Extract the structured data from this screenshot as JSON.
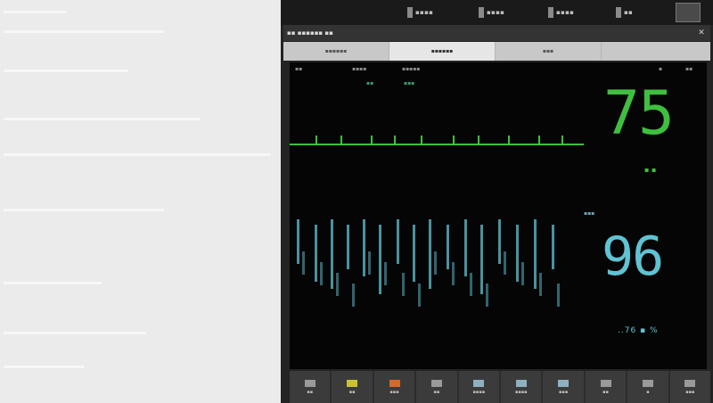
{
  "left_panel": {},
  "topbar": {
    "items": [
      {
        "icon": "battery-icon",
        "label": "▪▪▪▪"
      },
      {
        "icon": "network-icon",
        "label": "▪▪▪▪"
      },
      {
        "icon": "sound-icon",
        "label": "▪▪▪▪"
      },
      {
        "icon": "alarm-icon",
        "label": "▪▪"
      }
    ],
    "corner_icon": "menu-icon"
  },
  "window": {
    "title": "▪▪ ▪▪▪▪▪▪ ▪▪",
    "close_label": "✕"
  },
  "tabs": [
    {
      "label": "▪▪▪▪▪▪",
      "active": false
    },
    {
      "label": "▪▪▪▪▪▪",
      "active": true
    },
    {
      "label": "▪▪▪",
      "active": false
    }
  ],
  "display": {
    "header_left": "▪▪",
    "header_mid_1": "▪▪▪▪",
    "header_mid_2": "▪▪▪▪▪",
    "header_right_1": "▪",
    "header_right_2": "▪▪",
    "ecg_lead": "▪▪",
    "ecg_lead_2": "▪▪▪",
    "hr_value": "75",
    "hr_unit": "▪ ▪",
    "pleth_label": "▪▪▪",
    "spo2_value": "96",
    "spo2_bottom": "..76 ▪ %",
    "colors": {
      "hr": "#3fbf3f",
      "spo2": "#5fc3d3",
      "background": "#050505"
    }
  },
  "toolbar": [
    {
      "icon": "doc-icon",
      "label": "▪▪"
    },
    {
      "icon": "star-icon",
      "label": "▪▪"
    },
    {
      "icon": "alert-icon",
      "label": "▪▪▪"
    },
    {
      "icon": "blank-icon",
      "label": "▪▪"
    },
    {
      "icon": "review-icon",
      "label": "▪▪▪▪"
    },
    {
      "icon": "trend-icon",
      "label": "▪▪▪▪"
    },
    {
      "icon": "print-icon",
      "label": "▪▪▪"
    },
    {
      "icon": "patient-icon",
      "label": "▪▪"
    },
    {
      "icon": "setup-icon",
      "label": "▪"
    },
    {
      "icon": "more-icon",
      "label": "▪▪▪"
    }
  ]
}
